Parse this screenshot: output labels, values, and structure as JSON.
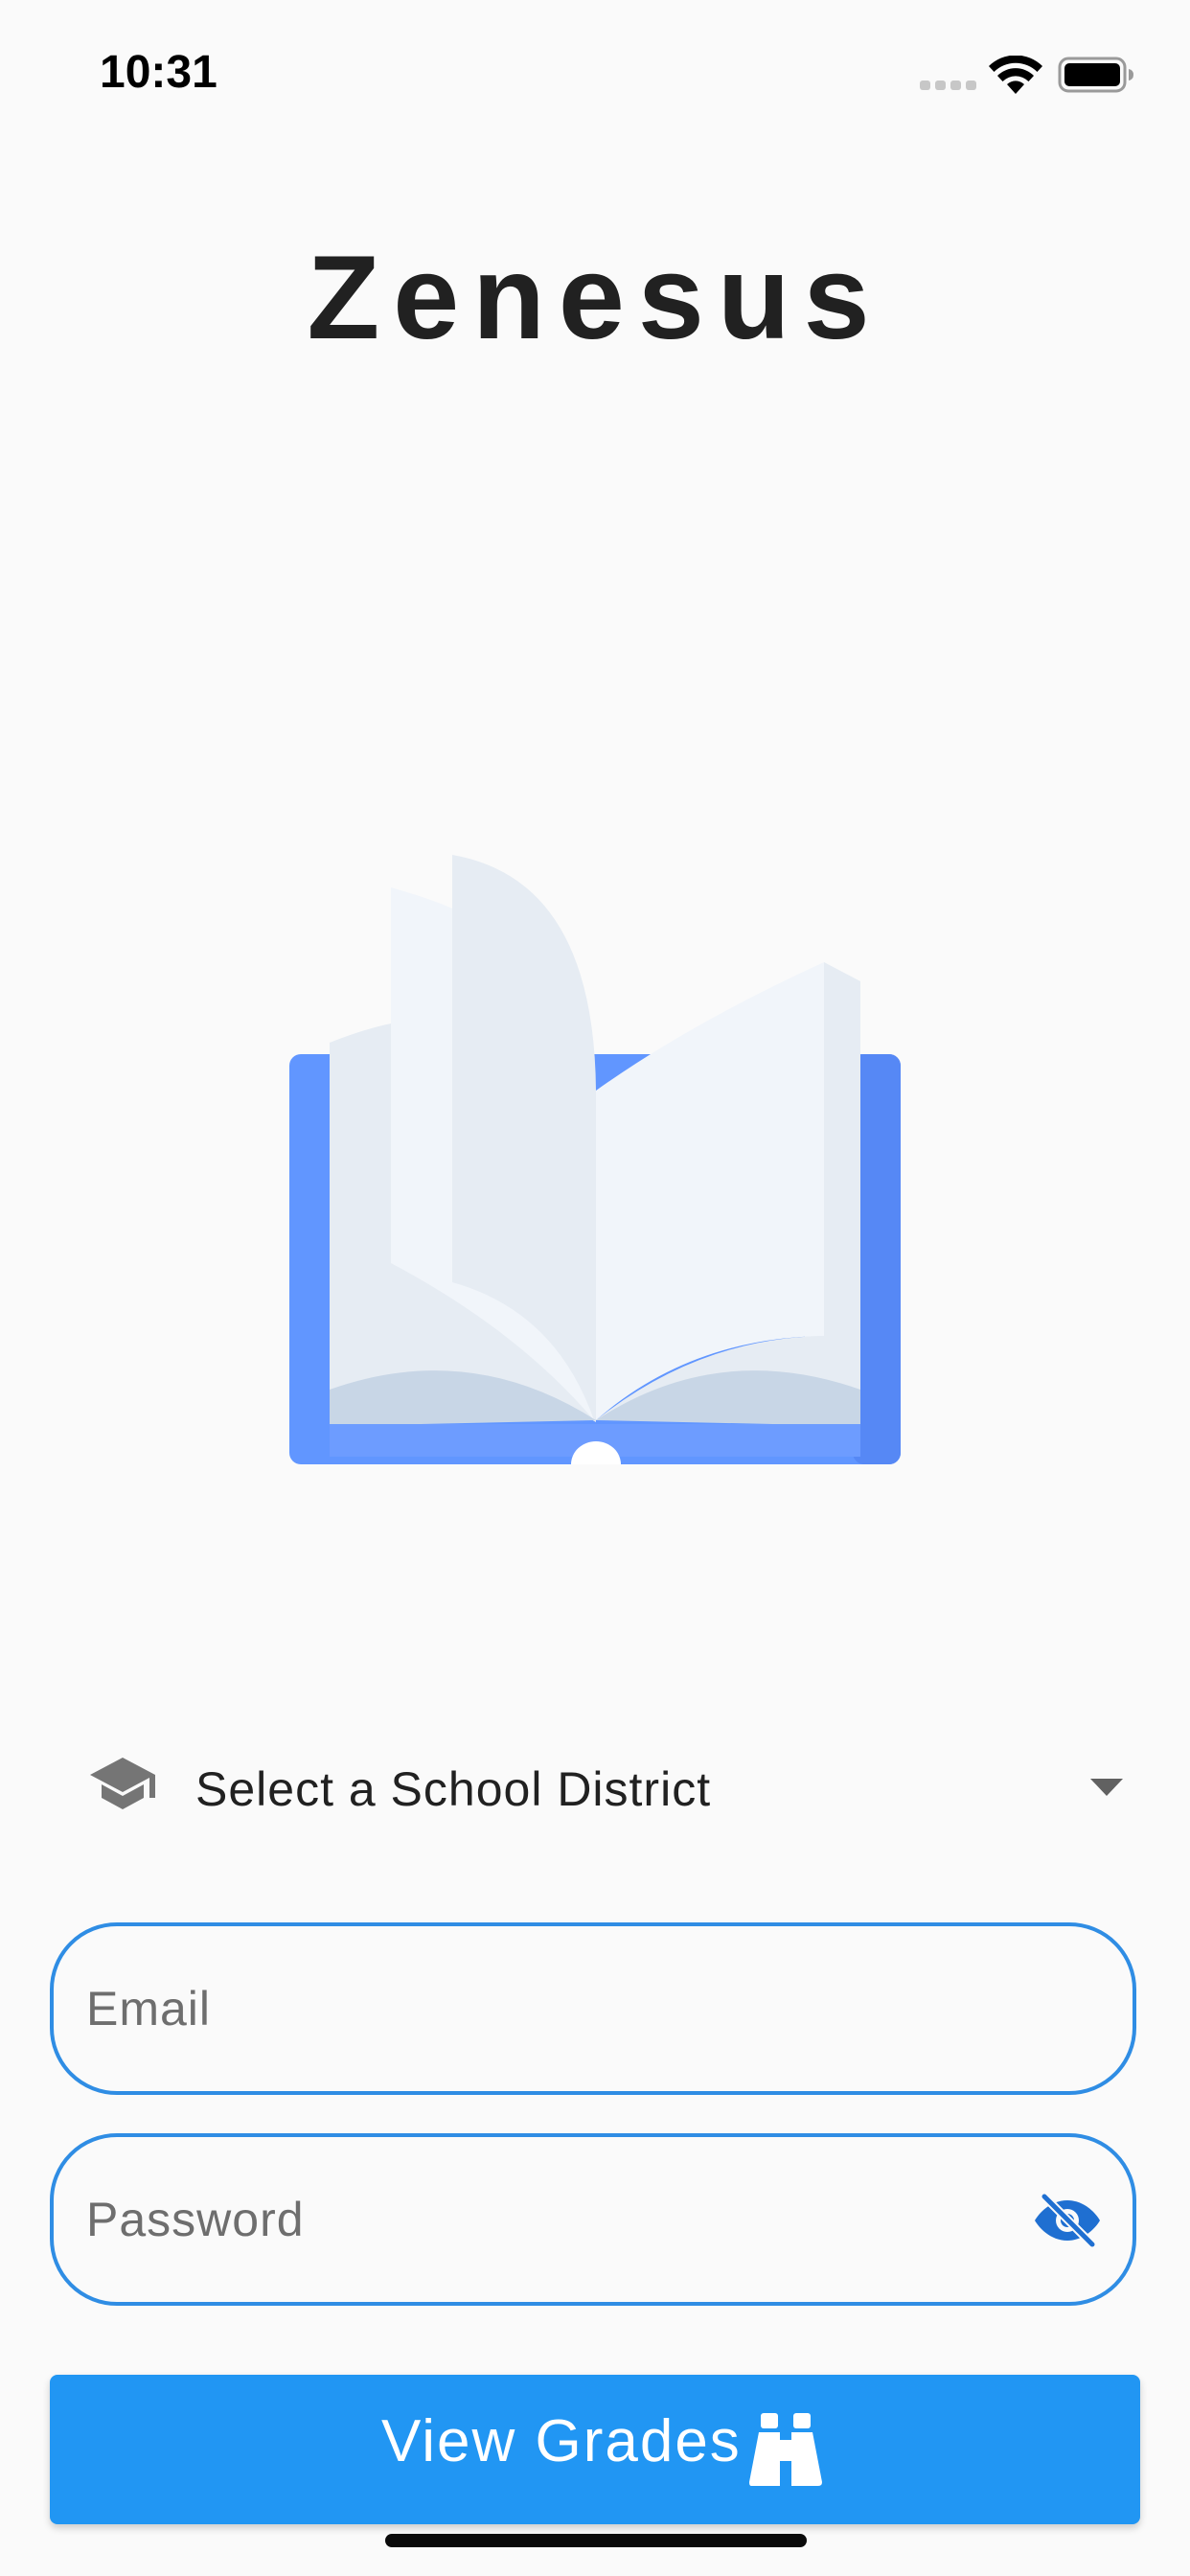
{
  "status_bar": {
    "time": "10:31",
    "icons": [
      "cellular-signal-icon",
      "wifi-icon",
      "battery-icon"
    ]
  },
  "app": {
    "title": "Zenesus"
  },
  "illustration": {
    "icon": "open-book-icon",
    "colors": {
      "cover": "#6196ff",
      "pages": "#e6ecf3",
      "pages_light": "#f1f5fa",
      "page_shadow": "#c8d6e6"
    }
  },
  "form": {
    "district": {
      "icon": "school-icon",
      "label": "Select a School District",
      "dropdown_icon": "arrow-drop-down-icon"
    },
    "email": {
      "placeholder": "Email",
      "value": ""
    },
    "password": {
      "placeholder": "Password",
      "value": "",
      "toggle_icon": "visibility-off-icon"
    },
    "submit": {
      "label": "View Grades",
      "icon": "binoculars-icon"
    }
  },
  "colors": {
    "background": "#fafafa",
    "accent": "#2196f3",
    "field_border": "#2f8de4",
    "text": "#212121",
    "placeholder": "#6e6e6e"
  }
}
